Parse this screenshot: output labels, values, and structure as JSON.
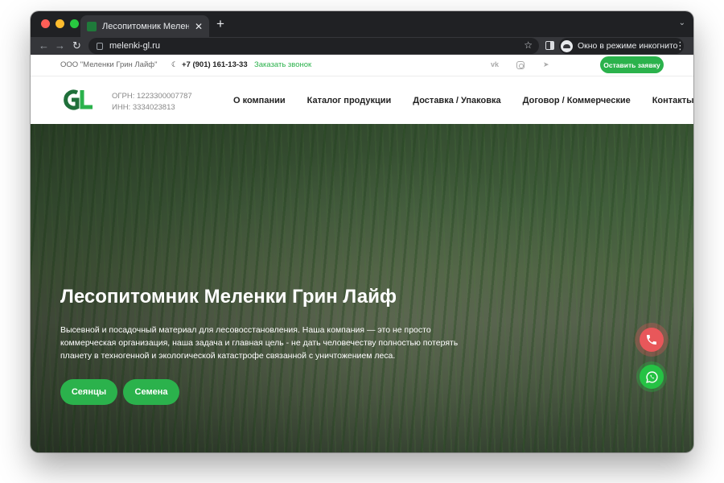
{
  "browser": {
    "tab_title": "Лесопитомник Меленки Гри",
    "tab_close": "✕",
    "new_tab": "+",
    "url": "melenki-gl.ru",
    "incognito_label": "Окно в режиме инкогнито"
  },
  "topbar": {
    "company": "ООО \"Меленки Грин Лайф\"",
    "phone": "+7 (901) 161-13-33",
    "callback": "Заказать звонок",
    "vk": "vk",
    "leave_request": "Оставить заявку"
  },
  "header": {
    "ogrn": "ОГРН: 1223300007787",
    "inn": "ИНН: 3334023813",
    "nav": [
      "О компании",
      "Каталог продукции",
      "Доставка / Упаковка",
      "Договор / Коммерческие",
      "Контакты"
    ]
  },
  "hero": {
    "title": "Лесопитомник Меленки Грин Лайф",
    "text": "Высевной и посадочный материал для лесовосстановления. Наша компания — это не просто коммерческая организация, наша задача и главная цель - не дать человечеству полностью потерять планету в техногенной и экологической катастрофе связанной с уничтожением леса.",
    "btn_seedlings": "Сеянцы",
    "btn_seeds": "Семена"
  },
  "colors": {
    "brand_green": "#2bb24c",
    "call_red": "#e8575a",
    "whatsapp_green": "#25c244"
  },
  "icons": {
    "phone": "phone-icon",
    "whatsapp": "whatsapp-icon",
    "vk": "vk-icon",
    "instagram": "instagram-icon",
    "telegram": "telegram-icon"
  }
}
